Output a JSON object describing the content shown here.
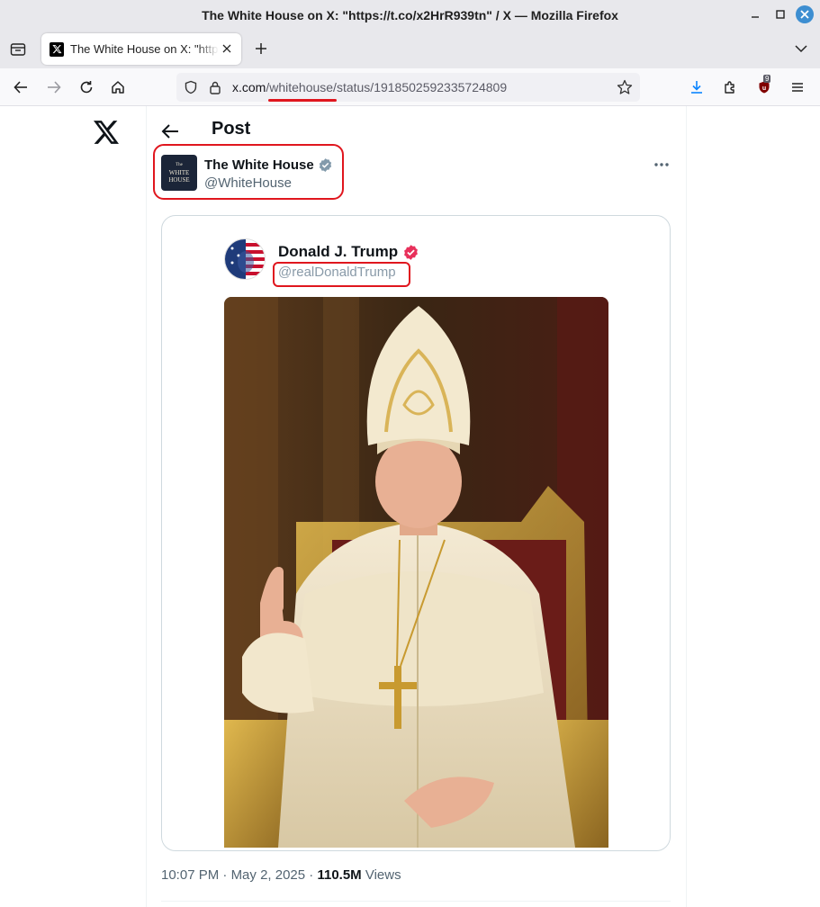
{
  "window": {
    "title": "The White House on X: \"https://t.co/x2HrR939tn\" / X — Mozilla Firefox"
  },
  "tabs": [
    {
      "title": "The White House on X: \"https://t.co/x2HrR939tn\" / X",
      "favicon": "x-logo-icon"
    }
  ],
  "navbar": {
    "url_host": "x.com",
    "url_path": "/whitehouse/status/1918502592335724809",
    "downloads_icon_color": "#0a84ff",
    "extension_badge": "9"
  },
  "page": {
    "heading": "Post",
    "author": {
      "name": "The White House",
      "handle": "@WhiteHouse",
      "avatar_text": [
        "The",
        "WHITE",
        "HOUSE"
      ],
      "verified_badge": "gray"
    },
    "quoted_post": {
      "name": "Donald J. Trump",
      "handle": "@realDonaldTrump",
      "verified_badge": "pink",
      "image": "portrait-in-papal-vestments"
    },
    "meta": {
      "time": "10:07 PM",
      "separator": "·",
      "date": "May 2, 2025",
      "views_count": "110.5M",
      "views_label": "Views"
    }
  },
  "colors": {
    "highlight": "#e0161e",
    "text_primary": "#0f1419",
    "text_secondary": "#536471"
  }
}
